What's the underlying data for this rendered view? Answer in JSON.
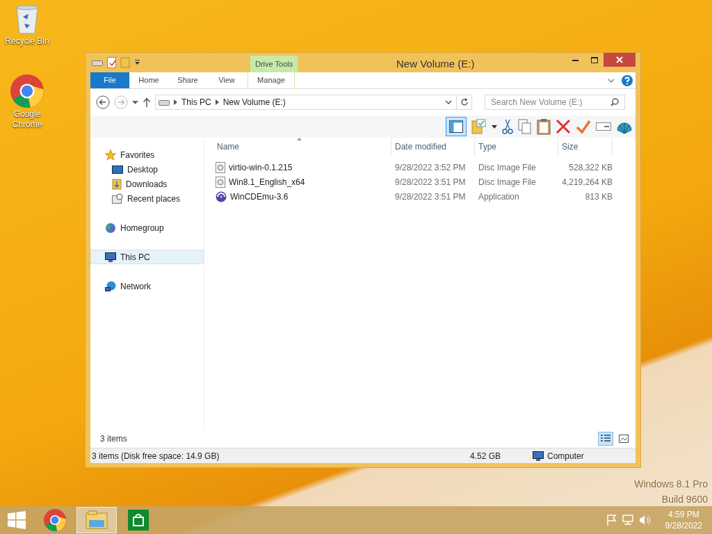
{
  "desktop_icons": [
    {
      "label": "Recycle Bin",
      "kind": "bin"
    },
    {
      "label": "Google Chrome",
      "kind": "chrome"
    }
  ],
  "window": {
    "title": "New Volume (E:)",
    "context_group": "Drive Tools",
    "ribbon_tabs": [
      {
        "label": "File",
        "kind": "file"
      },
      {
        "label": "Home",
        "kind": "tab"
      },
      {
        "label": "Share",
        "kind": "tab"
      },
      {
        "label": "View",
        "kind": "tab"
      },
      {
        "label": "Manage",
        "kind": "context"
      }
    ],
    "breadcrumbs": [
      "This PC",
      "New Volume (E:)"
    ],
    "search": {
      "placeholder": "Search New Volume (E:)"
    },
    "nav": [
      {
        "label": "Favorites",
        "kind": "star",
        "selected": false,
        "children": [
          {
            "label": "Desktop",
            "kind": "desktop",
            "selected": false
          },
          {
            "label": "Downloads",
            "kind": "folder",
            "selected": false
          },
          {
            "label": "Recent places",
            "kind": "recent",
            "selected": false
          }
        ]
      },
      {
        "label": "Homegroup",
        "kind": "homegroup",
        "selected": false
      },
      {
        "label": "This PC",
        "kind": "pc",
        "selected": true
      },
      {
        "label": "Network",
        "kind": "network",
        "selected": false
      }
    ],
    "columns": [
      "Name",
      "Date modified",
      "Type",
      "Size"
    ],
    "rows": [
      {
        "kind": "disc",
        "name": "virtio-win-0.1.215",
        "date": "9/28/2022 3:52 PM",
        "type": "Disc Image File",
        "size": "528,322 KB"
      },
      {
        "kind": "disc",
        "name": "Win8.1_English_x64",
        "date": "9/28/2022 3:51 PM",
        "type": "Disc Image File",
        "size": "4,219,264 KB"
      },
      {
        "kind": "app",
        "name": "WinCDEmu-3.6",
        "date": "9/28/2022 3:51 PM",
        "type": "Application",
        "size": "813 KB"
      }
    ],
    "item_count": "3 items",
    "status": {
      "text": "3 items (Disk free space: 14.9 GB)",
      "size": "4.52 GB",
      "location": "Computer"
    }
  },
  "watermark_os": [
    "Windows 8.1 Pro",
    "Build 9600"
  ],
  "taskbar": {
    "buttons": [
      {
        "kind": "start",
        "active": false
      },
      {
        "kind": "chrome",
        "active": false
      },
      {
        "kind": "explorer",
        "active": true
      },
      {
        "kind": "store",
        "active": false
      }
    ],
    "time": "4:59 PM",
    "date": "9/28/2022"
  }
}
